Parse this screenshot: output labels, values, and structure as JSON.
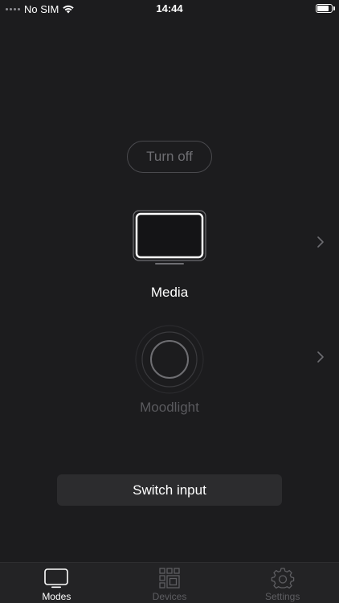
{
  "status_bar": {
    "carrier": "No SIM",
    "time": "14:44",
    "battery_level": 0.8
  },
  "actions": {
    "turn_off_label": "Turn off",
    "switch_input_label": "Switch input"
  },
  "modes": [
    {
      "label": "Media",
      "icon": "tv-icon",
      "active": true
    },
    {
      "label": "Moodlight",
      "icon": "moodlight-icon",
      "active": false
    }
  ],
  "tabs": [
    {
      "label": "Modes",
      "icon": "tv-icon",
      "active": true
    },
    {
      "label": "Devices",
      "icon": "devices-grid-icon",
      "active": false
    },
    {
      "label": "Settings",
      "icon": "gear-icon",
      "active": false
    }
  ],
  "colors": {
    "background": "#1c1c1e",
    "active_text": "#ffffff",
    "inactive_text": "#5a5a5e",
    "button_bg": "#2c2c2e",
    "tab_bar_bg": "#232325"
  }
}
